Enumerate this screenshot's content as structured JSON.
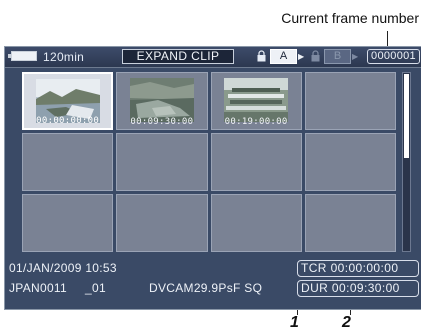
{
  "annotations": {
    "frame_number_label": "Current frame number",
    "callout_1": "1",
    "callout_2": "2"
  },
  "status_bar": {
    "battery_time": "120min",
    "mode": "EXPAND CLIP",
    "slot_a": "A",
    "slot_b": "B",
    "frame_number": "0000001"
  },
  "thumbnails": [
    {
      "timecode": "00:00:00:00",
      "selected": true
    },
    {
      "timecode": "00:09:30:00",
      "selected": false
    },
    {
      "timecode": "00:19:00:00",
      "selected": false
    }
  ],
  "info": {
    "date_time": "01/JAN/2009 10:53",
    "clip_name": "JPAN0011",
    "clip_suffix": "_01",
    "format": "DVCAM29.9PsF SQ",
    "tcr": "TCR 00:00:00:00",
    "dur": "DUR 00:09:30:00"
  },
  "colors": {
    "screen_bg": "#3a4a66",
    "cell_bg": "#7a8294",
    "selected_cell": "#d8dce4"
  }
}
